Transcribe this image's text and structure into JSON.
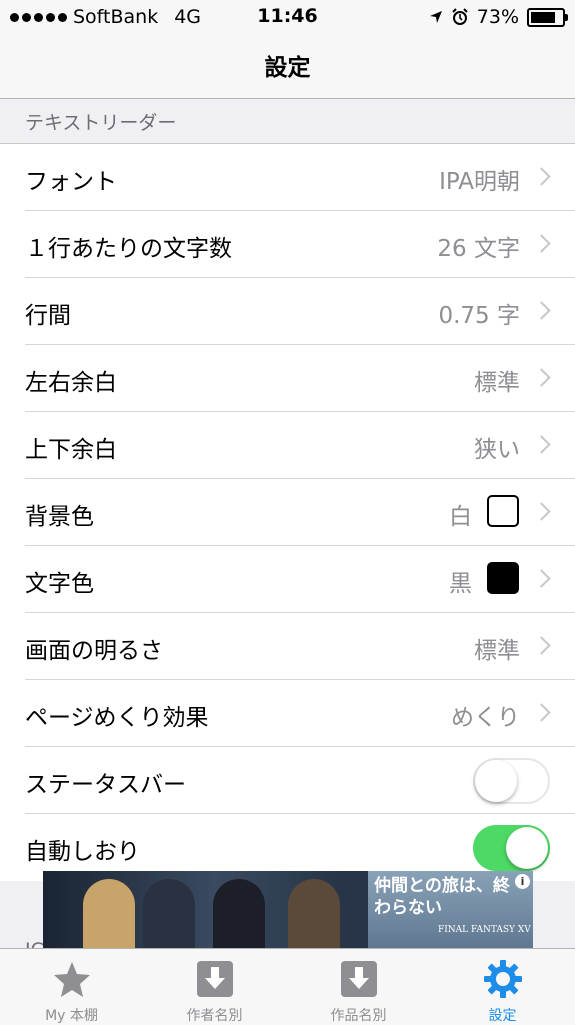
{
  "status_bar": {
    "carrier": "SoftBank",
    "network": "4G",
    "time": "11:46",
    "battery": "73%"
  },
  "nav": {
    "title": "設定"
  },
  "section": {
    "header": "テキストリーダー",
    "header_2_partial": "IC"
  },
  "rows": [
    {
      "label": "フォント",
      "value": "IPA明朝"
    },
    {
      "label": "１行あたりの文字数",
      "value": "26 文字"
    },
    {
      "label": "行間",
      "value": "0.75 字"
    },
    {
      "label": "左右余白",
      "value": "標準"
    },
    {
      "label": "上下余白",
      "value": "狭い"
    },
    {
      "label": "背景色",
      "value": "白",
      "swatch_color": "#ffffff"
    },
    {
      "label": "文字色",
      "value": "黒",
      "swatch_color": "#000000"
    },
    {
      "label": "画面の明るさ",
      "value": "標準"
    },
    {
      "label": "ページめくり効果",
      "value": "めくり"
    },
    {
      "label": "ステータスバー",
      "toggle": "off"
    },
    {
      "label": "自動しおり",
      "toggle": "on"
    }
  ],
  "ad": {
    "headline": "仲間との旅は、終わらない",
    "logo_text": "FINAL FANTASY XV",
    "info_icon": "i"
  },
  "tabs": [
    {
      "label": "My 本棚",
      "icon": "star-icon"
    },
    {
      "label": "作者名別",
      "icon": "download-icon"
    },
    {
      "label": "作品名別",
      "icon": "download-icon"
    },
    {
      "label": "設定",
      "icon": "gear-icon",
      "active": true
    }
  ],
  "colors": {
    "accent": "#1e8de9",
    "toggle_on": "#4cd964",
    "secondary_text": "#8e8e93"
  }
}
